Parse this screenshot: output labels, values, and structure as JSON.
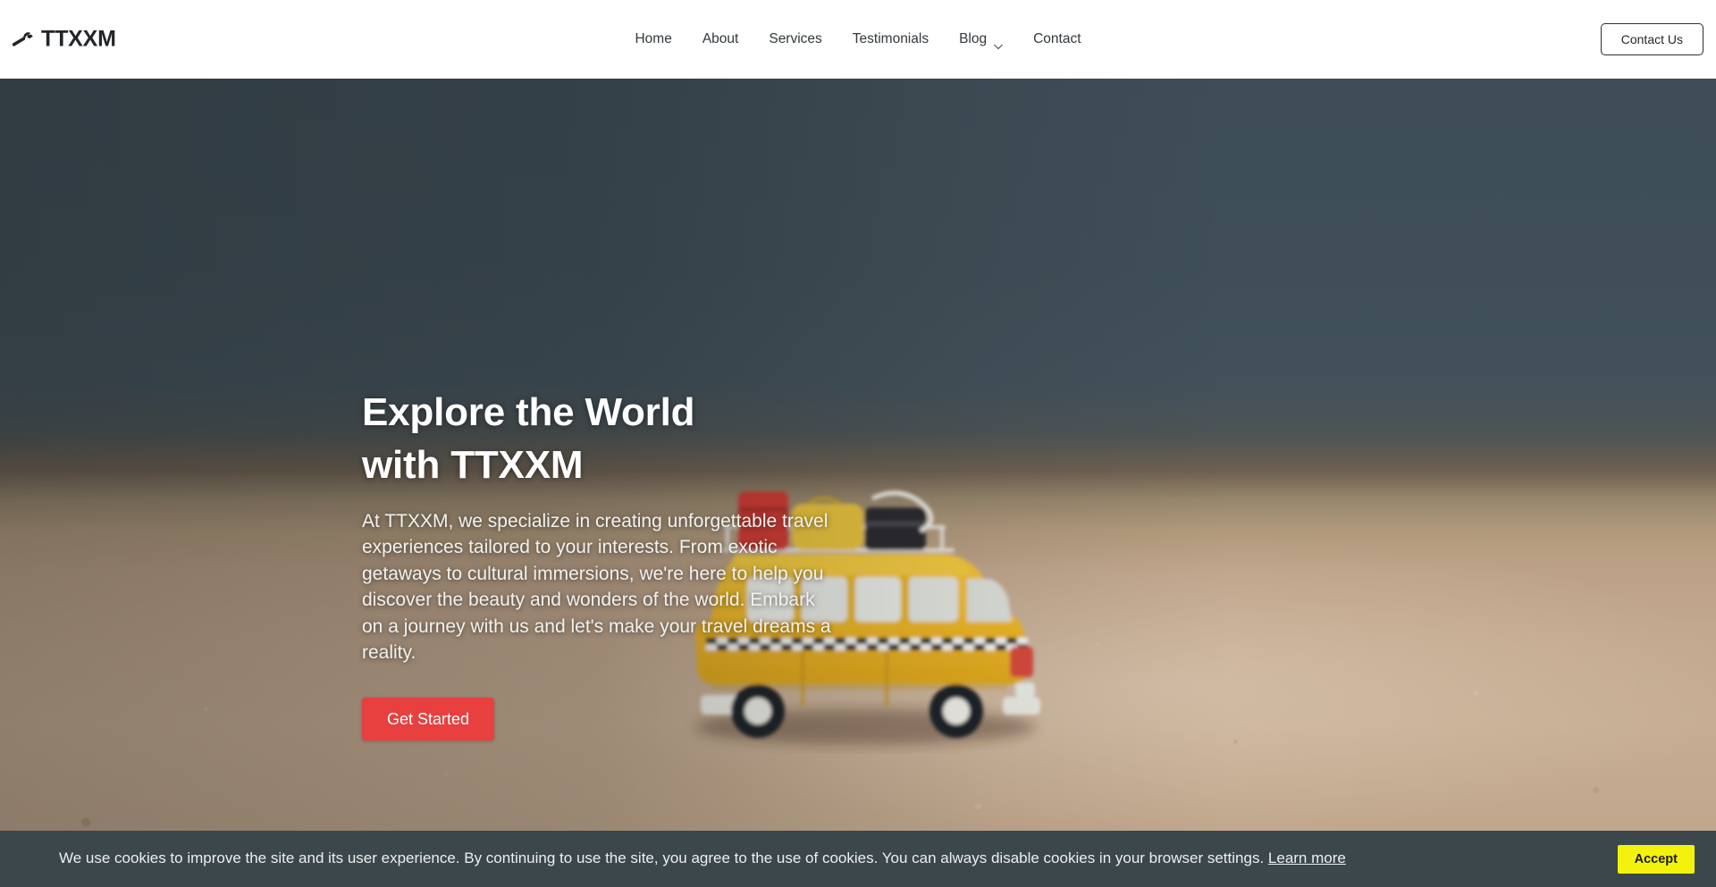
{
  "header": {
    "brand": {
      "name": "TTXXM",
      "icon": "wrench-icon"
    },
    "nav": [
      {
        "label": "Home",
        "icon": null
      },
      {
        "label": "About",
        "icon": null
      },
      {
        "label": "Services",
        "icon": null
      },
      {
        "label": "Testimonials",
        "icon": null
      },
      {
        "label": "Blog",
        "icon": "chevron-down-icon"
      },
      {
        "label": "Contact",
        "icon": null
      }
    ],
    "contact_button": "Contact Us"
  },
  "hero": {
    "title": "Explore the World with TTXXM",
    "description": "At TTXXM, we specialize in creating unforgettable travel experiences tailored to your interests. From exotic getaways to cultural immersions, we're here to help you discover the beauty and wonders of the world. Embark on a journey with us and let's make your travel dreams a reality.",
    "cta_label": "Get Started",
    "background_image": "yellow-toy-van-on-sand-beach"
  },
  "cookie_banner": {
    "message": "We use cookies to improve the site and its user experience. By continuing to use the site, you agree to the use of cookies. You can always disable cookies in your browser settings.",
    "link_label": "Learn more",
    "accept_label": "Accept"
  },
  "colors": {
    "cta_red": "#e8403f",
    "accept_yellow": "#f2f20d",
    "cookie_bar": "#3b474b",
    "header_bg": "#ffffff",
    "text_dark": "#23282b"
  }
}
